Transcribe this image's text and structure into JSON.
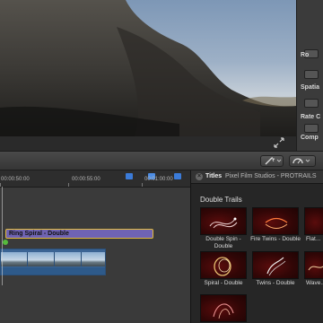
{
  "inspector": {
    "rows": [
      "Ro",
      "Spatia",
      "Rate C",
      "Comp"
    ]
  },
  "timeline": {
    "timecodes": [
      "00:00:50:00",
      "00:00:55:00",
      "00:01:00:00"
    ],
    "connected_clip_label": "Ring Spiral - Double",
    "primary_clip_thumbnails": 4
  },
  "browser": {
    "title": "Titles",
    "path": "Pixel Film Studios - PROTRAILS",
    "category": "Double Trails",
    "items": [
      {
        "label": "Double Spin - Double"
      },
      {
        "label": "Fire Twins - Double"
      },
      {
        "label": "Flat..."
      },
      {
        "label": "Spiral - Double"
      },
      {
        "label": "Twins - Double"
      },
      {
        "label": "Wave..."
      }
    ]
  },
  "icons": {
    "fullscreen": "expand-icon",
    "magic_wand": "wand-icon",
    "retime": "speedometer-icon",
    "close": "close-icon",
    "marker": "marker-icon"
  },
  "colors": {
    "connected_clip": "#6f63b3",
    "selection": "#e0b93a",
    "primary_clip": "#3b6494",
    "marker": "#3b7bd8",
    "tile_bg": "#300606"
  }
}
